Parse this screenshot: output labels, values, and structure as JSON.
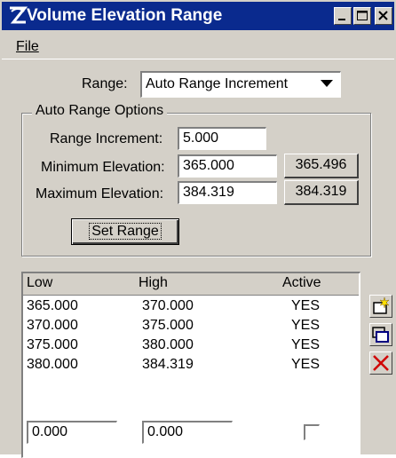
{
  "window": {
    "title": "Volume Elevation Range",
    "title_bar_color": "#0a2a8e"
  },
  "menu": {
    "file": "File"
  },
  "range": {
    "label": "Range:",
    "selected": "Auto Range Increment"
  },
  "auto_range": {
    "legend": "Auto Range Options",
    "increment_label": "Range Increment:",
    "increment_value": "5.000",
    "min_label": "Minimum Elevation:",
    "min_value": "365.000",
    "min_button": "365.496",
    "max_label": "Maximum Elevation:",
    "max_value": "384.319",
    "max_button": "384.319",
    "set_range": "Set Range"
  },
  "table": {
    "headers": [
      "Low",
      "High",
      "Active"
    ],
    "rows": [
      [
        "365.000",
        "370.000",
        "YES"
      ],
      [
        "370.000",
        "375.000",
        "YES"
      ],
      [
        "375.000",
        "380.000",
        "YES"
      ],
      [
        "380.000",
        "384.319",
        "YES"
      ]
    ]
  },
  "edit": {
    "low": "0.000",
    "high": "0.000",
    "active_checked": false
  },
  "side_icons": [
    "new-row-icon",
    "copy-icon",
    "delete-icon"
  ]
}
